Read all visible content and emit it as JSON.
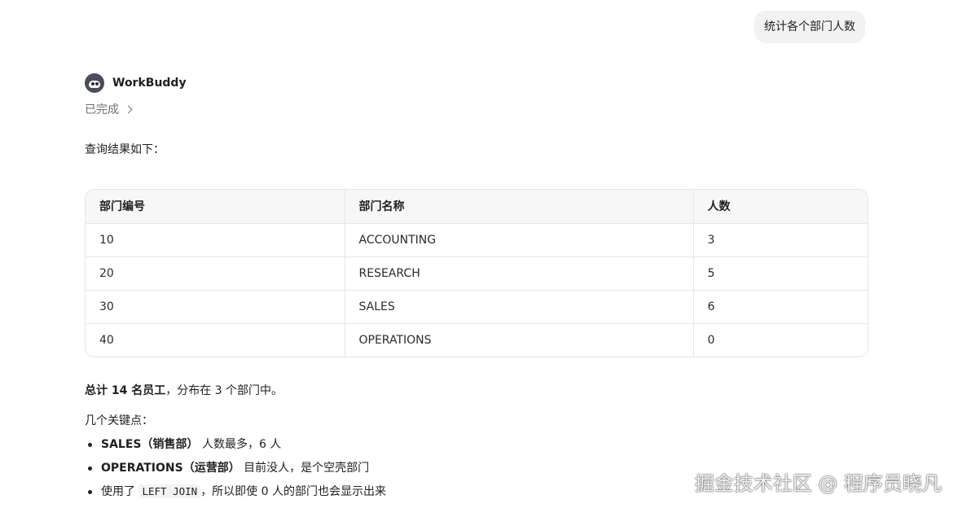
{
  "colors": {
    "user_bubble_bg": "#f2f2f2",
    "table_header_bg": "#f7f7f7",
    "table_border": "#e6e6e6",
    "muted_text": "#707070"
  },
  "user_message": {
    "text": "统计各个部门人数"
  },
  "assistant": {
    "avatar_icon": "raccoon-avatar-icon",
    "name": "WorkBuddy",
    "status_label": "已完成",
    "status_icon": "chevron-right-icon"
  },
  "response": {
    "intro": "查询结果如下：",
    "table": {
      "headers": [
        "部门编号",
        "部门名称",
        "人数"
      ],
      "rows": [
        [
          "10",
          "ACCOUNTING",
          "3"
        ],
        [
          "20",
          "RESEARCH",
          "5"
        ],
        [
          "30",
          "SALES",
          "6"
        ],
        [
          "40",
          "OPERATIONS",
          "0"
        ]
      ]
    },
    "summary_bold": "总计 14 名员工",
    "summary_rest": "，分布在 3 个部门中。",
    "keypoints_title": "几个关键点：",
    "bullets": [
      {
        "bold": "SALES（销售部）",
        "rest": " 人数最多，6 人"
      },
      {
        "bold": "OPERATIONS（运营部）",
        "rest": " 目前没人，是个空壳部门"
      },
      {
        "prefix": "使用了 ",
        "code": "LEFT JOIN",
        "suffix": "，所以即使 0 人的部门也会显示出来"
      }
    ]
  },
  "watermark": "掘金技术社区 @ 程序员晓凡"
}
